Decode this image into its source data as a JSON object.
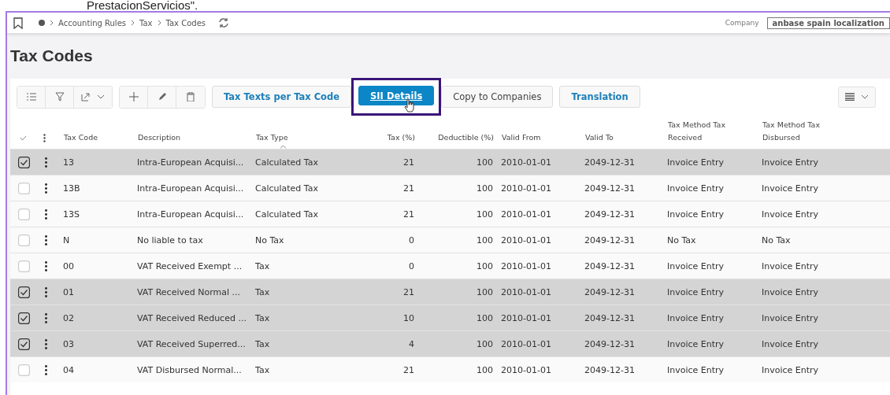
{
  "caption": "PrestacionServicios\".",
  "breadcrumb": [
    "Accounting Rules",
    "Tax",
    "Tax Codes"
  ],
  "company": {
    "label": "Company",
    "value": "anbase spain localization"
  },
  "title": "Tax Codes",
  "toolbar": {
    "actions": [
      {
        "label": "Tax Texts per Tax Code",
        "kind": "secondary",
        "highlighted": false
      },
      {
        "label": "SII Details",
        "kind": "primary",
        "highlighted": true
      },
      {
        "label": "Copy to Companies",
        "kind": "plain",
        "highlighted": false
      },
      {
        "label": "Translation",
        "kind": "secondary",
        "highlighted": false
      }
    ]
  },
  "table": {
    "columns": [
      "Tax Code",
      "Description",
      "Tax Type",
      "Tax (%)",
      "Deductible (%)",
      "Valid From",
      "Valid To",
      "Tax Method Tax Received",
      "Tax Method Tax Disbursed"
    ],
    "rows": [
      {
        "selected": true,
        "cells": [
          "13",
          "Intra-European Acquisi...",
          "Calculated Tax",
          "21",
          "100",
          "2010-01-01",
          "2049-12-31",
          "Invoice Entry",
          "Invoice Entry"
        ]
      },
      {
        "selected": false,
        "cells": [
          "13B",
          "Intra-European Acquisi...",
          "Calculated Tax",
          "21",
          "100",
          "2010-01-01",
          "2049-12-31",
          "Invoice Entry",
          "Invoice Entry"
        ]
      },
      {
        "selected": false,
        "cells": [
          "13S",
          "Intra-European Acquisi...",
          "Calculated Tax",
          "21",
          "100",
          "2010-01-01",
          "2049-12-31",
          "Invoice Entry",
          "Invoice Entry"
        ]
      },
      {
        "selected": false,
        "cells": [
          "N",
          "No liable to tax",
          "No Tax",
          "0",
          "100",
          "2010-01-01",
          "2049-12-31",
          "No Tax",
          "No Tax"
        ]
      },
      {
        "selected": false,
        "cells": [
          "00",
          "VAT Received Exempt ...",
          "Tax",
          "0",
          "100",
          "2010-01-01",
          "2049-12-31",
          "Invoice Entry",
          "Invoice Entry"
        ]
      },
      {
        "selected": true,
        "cells": [
          "01",
          "VAT Received Normal ...",
          "Tax",
          "21",
          "100",
          "2010-01-01",
          "2049-12-31",
          "Invoice Entry",
          "Invoice Entry"
        ]
      },
      {
        "selected": true,
        "cells": [
          "02",
          "VAT Received Reduced ...",
          "Tax",
          "10",
          "100",
          "2010-01-01",
          "2049-12-31",
          "Invoice Entry",
          "Invoice Entry"
        ]
      },
      {
        "selected": true,
        "cells": [
          "03",
          "VAT Received Superred...",
          "Tax",
          "4",
          "100",
          "2010-01-01",
          "2049-12-31",
          "Invoice Entry",
          "Invoice Entry"
        ]
      },
      {
        "selected": false,
        "cells": [
          "04",
          "VAT Disbursed Normal...",
          "Tax",
          "21",
          "100",
          "2010-01-01",
          "2049-12-31",
          "Invoice Entry",
          "Invoice Entry"
        ]
      }
    ]
  }
}
